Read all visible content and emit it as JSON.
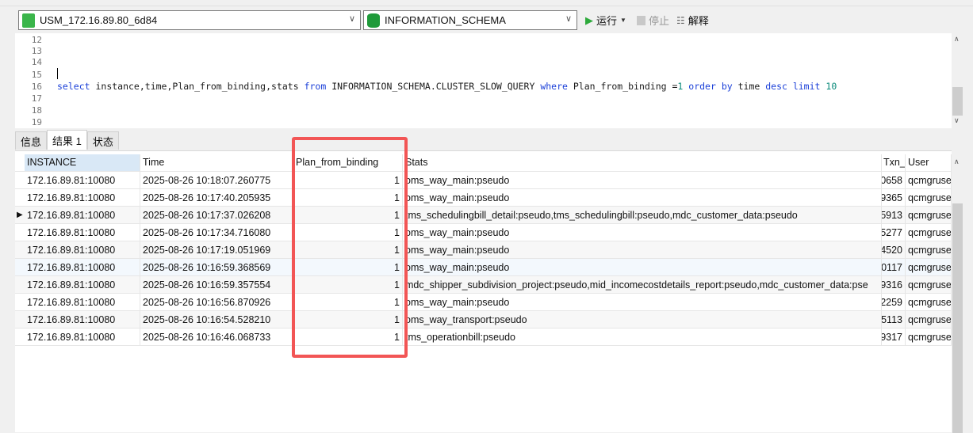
{
  "toolbar": {
    "connection": "USM_172.16.89.80_6d84",
    "database": "INFORMATION_SCHEMA",
    "run_label": "运行",
    "stop_label": "停止",
    "explain_label": "解释",
    "colors": {
      "run": "#2eaa3c",
      "connection_icon": "#3ab54a",
      "db_icon": "#1f9a3a"
    }
  },
  "editor": {
    "lines": [
      {
        "n": "12",
        "t": ""
      },
      {
        "n": "13",
        "t": ""
      },
      {
        "n": "14",
        "t": ""
      },
      {
        "n": "15",
        "t": ""
      },
      {
        "n": "16",
        "t": "select"
      },
      {
        "n": "17",
        "t": ""
      },
      {
        "n": "18",
        "t": ""
      },
      {
        "n": "19",
        "t": ""
      }
    ],
    "sql": {
      "kw1": "select",
      "p1": " instance,time,Plan_from_binding,stats ",
      "kw2": "from",
      "p2": " INFORMATION_SCHEMA.CLUSTER_SLOW_QUERY ",
      "kw3": "where",
      "p3": " Plan_from_binding =",
      "n1": "1",
      "kw4": " order by",
      "p4": " time ",
      "kw5": "desc limit",
      "n2": " 10"
    }
  },
  "tabs": [
    {
      "label": "信息"
    },
    {
      "label": "结果 1"
    },
    {
      "label": "状态"
    }
  ],
  "grid": {
    "columns": [
      "INSTANCE",
      "Time",
      "Plan_from_binding",
      "Stats",
      "Txn_",
      "User"
    ],
    "rows": [
      [
        "172.16.89.81:10080",
        "2025-08-26 10:18:07.260775",
        "1",
        "oms_way_main:pseudo",
        "0658",
        "qcmgruse"
      ],
      [
        "172.16.89.81:10080",
        "2025-08-26 10:17:40.205935",
        "1",
        "oms_way_main:pseudo",
        "9365",
        "qcmgruse"
      ],
      [
        "172.16.89.81:10080",
        "2025-08-26 10:17:37.026208",
        "1",
        "tms_schedulingbill_detail:pseudo,tms_schedulingbill:pseudo,mdc_customer_data:pseudo",
        "5913",
        "qcmgruse"
      ],
      [
        "172.16.89.81:10080",
        "2025-08-26 10:17:34.716080",
        "1",
        "oms_way_main:pseudo",
        "5277",
        "qcmgruse"
      ],
      [
        "172.16.89.81:10080",
        "2025-08-26 10:17:19.051969",
        "1",
        "oms_way_main:pseudo",
        "4520",
        "qcmgruse"
      ],
      [
        "172.16.89.81:10080",
        "2025-08-26 10:16:59.368569",
        "1",
        "oms_way_main:pseudo",
        "0117",
        "qcmgruse"
      ],
      [
        "172.16.89.81:10080",
        "2025-08-26 10:16:59.357554",
        "1",
        "mdc_shipper_subdivision_project:pseudo,mid_incomecostdetails_report:pseudo,mdc_customer_data:pse",
        "9316",
        "qcmgruse"
      ],
      [
        "172.16.89.81:10080",
        "2025-08-26 10:16:56.870926",
        "1",
        "oms_way_main:pseudo",
        "2259",
        "qcmgruse"
      ],
      [
        "172.16.89.81:10080",
        "2025-08-26 10:16:54.528210",
        "1",
        "oms_way_transport:pseudo",
        "5113",
        "qcmgruse"
      ],
      [
        "172.16.89.81:10080",
        "2025-08-26 10:16:46.068733",
        "1",
        "tms_operationbill:pseudo",
        "9317",
        "qcmgruse"
      ]
    ],
    "current_row": 2
  }
}
